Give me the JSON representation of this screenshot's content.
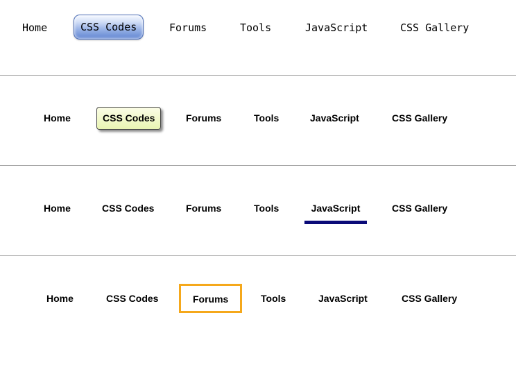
{
  "menus": [
    {
      "items": [
        "Home",
        "CSS Codes",
        "Forums",
        "Tools",
        "JavaScript",
        "CSS Gallery"
      ],
      "active": "CSS Codes",
      "accent": "#5f84d1"
    },
    {
      "items": [
        "Home",
        "CSS Codes",
        "Forums",
        "Tools",
        "JavaScript",
        "CSS Gallery"
      ],
      "active": "CSS Codes",
      "accent": "#e9f4b3"
    },
    {
      "items": [
        "Home",
        "CSS Codes",
        "Forums",
        "Tools",
        "JavaScript",
        "CSS Gallery"
      ],
      "active": "JavaScript",
      "accent": "#0a0a78"
    },
    {
      "items": [
        "Home",
        "CSS Codes",
        "Forums",
        "Tools",
        "JavaScript",
        "CSS Gallery"
      ],
      "active": "Forums",
      "accent": "#f5a81b"
    }
  ]
}
